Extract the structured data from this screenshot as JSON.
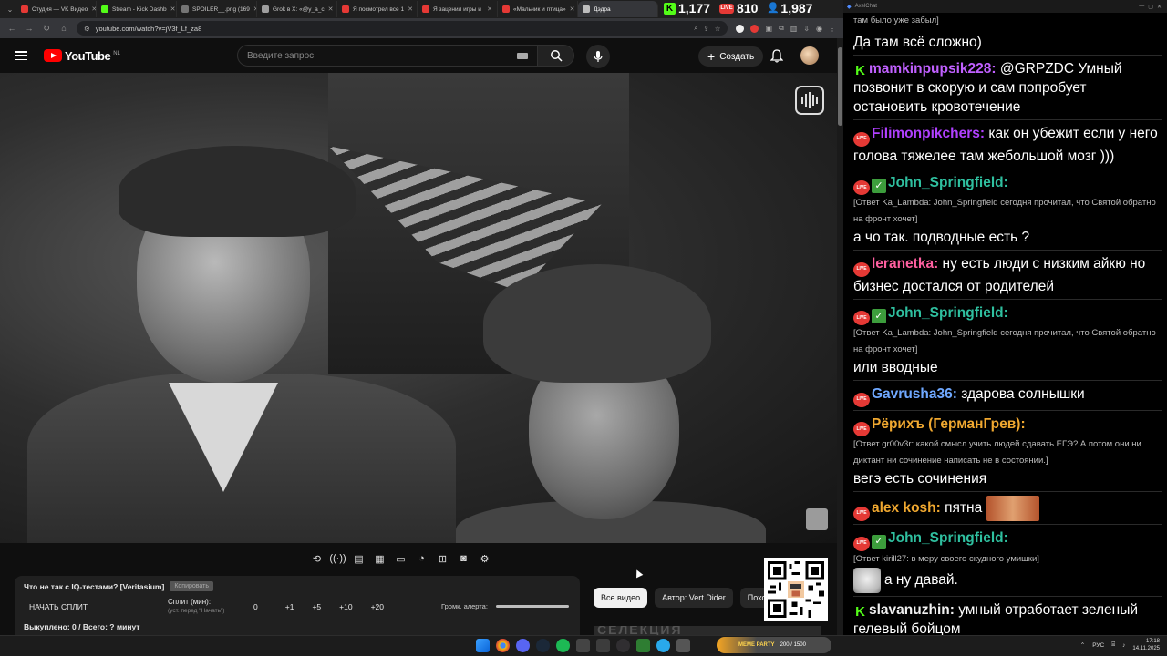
{
  "browser": {
    "tabs": [
      {
        "title": "Студия — VK Видео",
        "color": "#e53935"
      },
      {
        "title": "Stream - Kick Dashb",
        "color": "#53fc18"
      },
      {
        "title": "SPOILER__.png (169",
        "color": "#757575"
      },
      {
        "title": "Grok в X: «@y_a_c",
        "color": "#9e9e9e"
      },
      {
        "title": "Я посмотрел все 1",
        "color": "#e53935"
      },
      {
        "title": "Я заценил игры и",
        "color": "#e53935"
      },
      {
        "title": "«Мальчик и птица»",
        "color": "#e53935"
      },
      {
        "title": "Дэдра",
        "color": "#bdbdbd"
      }
    ],
    "url": "youtube.com/watch?v=jV3f_Lf_za8"
  },
  "stream_counters": {
    "kick": "1,177",
    "live": "810",
    "viewers": "1,987"
  },
  "youtube": {
    "logo": "YouTube",
    "region": "NL",
    "search_placeholder": "Введите запрос",
    "create_label": "Создать"
  },
  "split_panel": {
    "title": "Что не так с IQ-тестами? [Veritasium]",
    "copy_label": "Копировать",
    "start_label": "НАЧАТЬ СПЛИТ",
    "split_label": "Сплит (мин):",
    "split_hint": "(уст. перед \"Начать\")",
    "split_value": "0",
    "steps": [
      "+1",
      "+5",
      "+10",
      "+20"
    ],
    "alert_label": "Громк. алерта:",
    "total": "Выкуплено: 0 / Всего: ? минут"
  },
  "chips": [
    "Все видео",
    "Автор: Vert Dider",
    "Похожие"
  ],
  "thumb_text": "СЕЛЕКЦИЯ",
  "chat_window": {
    "title": "AxelChat"
  },
  "chat": [
    {
      "text": "там было уже забыл]",
      "kind": "reply-tail"
    },
    {
      "text": "Да там всё сложно)",
      "kind": "plain"
    },
    {
      "badges": [
        "kick"
      ],
      "name": "mamkinpupsik228:",
      "color": "#c060ff",
      "text": " @GRPZDC Умный позвонит в скорую и сам попробует остановить кровотечение"
    },
    {
      "badges": [
        "live"
      ],
      "name": "Filimonpikchers:",
      "color": "#b040ff",
      "text": " как он убежит если у него голова тяжелее там жебольшой мозг )))"
    },
    {
      "badges": [
        "live",
        "check"
      ],
      "name": "John_Springfield:",
      "color": "#2fbf9f",
      "reply": "[Ответ Ka_Lambda: John_Springfield сегодня прочитал, что Святой обратно на фронт хочет]",
      "text": "а чо так. подводные есть ?"
    },
    {
      "badges": [
        "live"
      ],
      "name": "leranetka:",
      "color": "#ff5fa0",
      "text": " ну есть люди с низким айкю но бизнес достался от родителей"
    },
    {
      "badges": [
        "live",
        "check"
      ],
      "name": "John_Springfield:",
      "color": "#2fbf9f",
      "reply": "[Ответ Ka_Lambda: John_Springfield сегодня прочитал, что Святой обратно на фронт хочет]",
      "text": "или вводные"
    },
    {
      "badges": [
        "live"
      ],
      "name": "Gavrusha36:",
      "color": "#6fa8ff",
      "text": " здарова солнышки"
    },
    {
      "badges": [
        "live"
      ],
      "name": "Рёрихъ (ГерманГрев):",
      "color": "#f0a830",
      "reply": "[Ответ gr00v3r: какой смысл учить людей сдавать ЕГЭ? А потом они ни диктант ни сочинение написать не в состоянии.]",
      "text": "вегэ есть сочинения"
    },
    {
      "badges": [
        "live"
      ],
      "name": "alex kosh:",
      "color": "#f0a830",
      "text": " пятна",
      "emote": true
    },
    {
      "badges": [
        "live",
        "check"
      ],
      "name": "John_Springfield:",
      "color": "#2fbf9f",
      "reply": "[Ответ kirill27: в меру своего скудного умишки]",
      "text": "а ну давай.",
      "cat": true
    },
    {
      "badges": [
        "kick"
      ],
      "name": "slavanuzhin:",
      "color": "#f0f0f0",
      "text": " умный отработает зеленый гелевый бойцом"
    }
  ],
  "taskbar": {
    "widget_name": "MEME PARTY",
    "widget_progress": "200 / 1500",
    "lang": "РУС",
    "time": "17:18",
    "date": "14.11.2025"
  },
  "colors": {
    "youtube_red": "#ff0000",
    "kick_green": "#53fc18",
    "live_red": "#e53935"
  }
}
